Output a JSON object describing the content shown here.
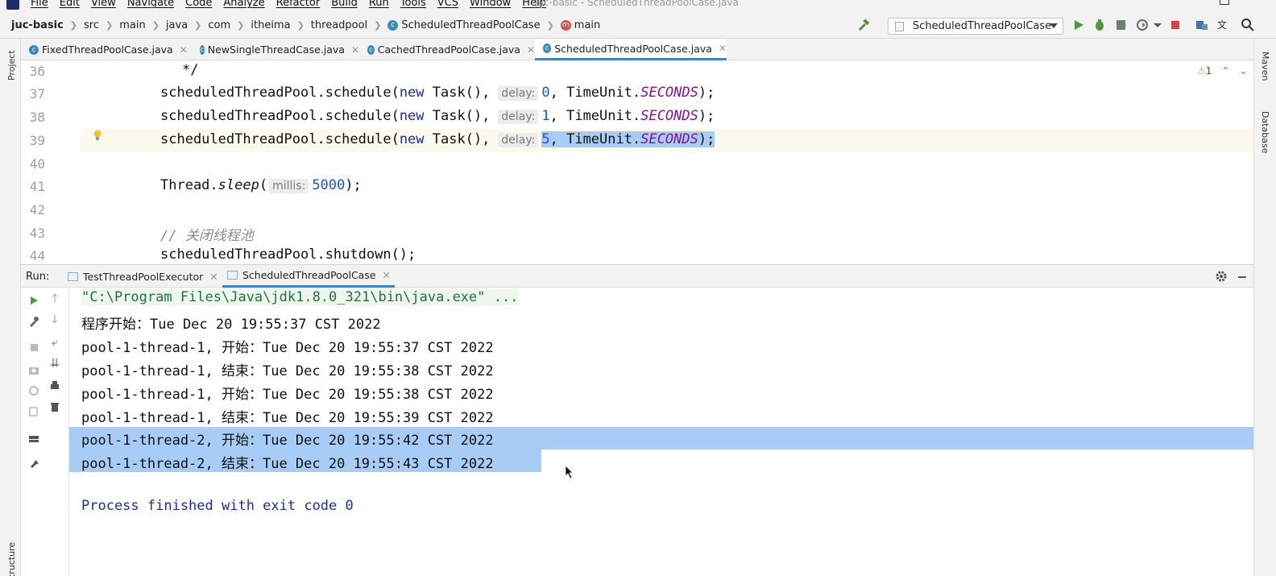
{
  "menu": {
    "items": [
      "File",
      "Edit",
      "View",
      "Navigate",
      "Code",
      "Analyze",
      "Refactor",
      "Build",
      "Run",
      "Tools",
      "VCS",
      "Window",
      "Help"
    ],
    "window_title": "juc-basic - ScheduledThreadPoolCase.java"
  },
  "breadcrumbs": [
    "juc-basic",
    "src",
    "main",
    "java",
    "com",
    "itheima",
    "threadpool",
    "ScheduledThreadPoolCase",
    "main"
  ],
  "run_config": "ScheduledThreadPoolCase",
  "editor_tabs": [
    {
      "label": "FixedThreadPoolCase.java",
      "active": false
    },
    {
      "label": "NewSingleThreadCase.java",
      "active": false
    },
    {
      "label": "CachedThreadPoolCase.java",
      "active": false
    },
    {
      "label": "ScheduledThreadPoolCase.java",
      "active": true
    }
  ],
  "side_tools": {
    "project": "Project",
    "structure": "Structure",
    "maven": "Maven",
    "database": "Database"
  },
  "editor": {
    "warnings": "1",
    "lines": [
      {
        "no": "36",
        "text": "*/"
      },
      {
        "no": "37",
        "pre": "scheduledThreadPool.schedule(",
        "kw": "new",
        "mid": " Task(),",
        "hint": "delay:",
        "num": "0",
        "post": ", TimeUnit.",
        "const": "SECONDS",
        "end": ");"
      },
      {
        "no": "38",
        "pre": "scheduledThreadPool.schedule(",
        "kw": "new",
        "mid": " Task(),",
        "hint": "delay:",
        "num": "1",
        "post": ", TimeUnit.",
        "const": "SECONDS",
        "end": ");"
      },
      {
        "no": "39",
        "pre": "scheduledThreadPool.schedule(",
        "kw": "new",
        "mid": " Task(),",
        "hint": "delay:",
        "num": "5",
        "post": ", TimeUnit.",
        "const": "SECONDS",
        "end": ");"
      },
      {
        "no": "40"
      },
      {
        "no": "41",
        "pre": "Thread.",
        "ital": "sleep",
        "open": "(",
        "hint": "millis:",
        "num": "5000",
        "end": ");"
      },
      {
        "no": "42"
      },
      {
        "no": "43",
        "comment": "// 关闭线程池"
      },
      {
        "no": "44",
        "text": "scheduledThreadPool.shutdown();"
      }
    ]
  },
  "run_panel": {
    "label": "Run:",
    "tabs": [
      {
        "label": "TestThreadPoolExecutor",
        "active": false
      },
      {
        "label": "ScheduledThreadPoolCase",
        "active": true
      }
    ],
    "console": [
      "\"C:\\Program Files\\Java\\jdk1.8.0_321\\bin\\java.exe\" ...",
      "程序开始：Tue Dec 20 19:55:37 CST 2022",
      "pool-1-thread-1, 开始：Tue Dec 20 19:55:37 CST 2022",
      "pool-1-thread-1, 结束：Tue Dec 20 19:55:38 CST 2022",
      "pool-1-thread-1, 开始：Tue Dec 20 19:55:38 CST 2022",
      "pool-1-thread-1, 结束：Tue Dec 20 19:55:39 CST 2022",
      "pool-1-thread-2, 开始：Tue Dec 20 19:55:42 CST 2022",
      "pool-1-thread-2, 结束：Tue Dec 20 19:55:43 CST 2022",
      "",
      "Process finished with exit code 0"
    ]
  },
  "colors": {
    "accent": "#4083c9",
    "selection": "#a7cdf7",
    "keyword": "#1a2ea8",
    "constant": "#871094",
    "number": "#1a56d6"
  }
}
